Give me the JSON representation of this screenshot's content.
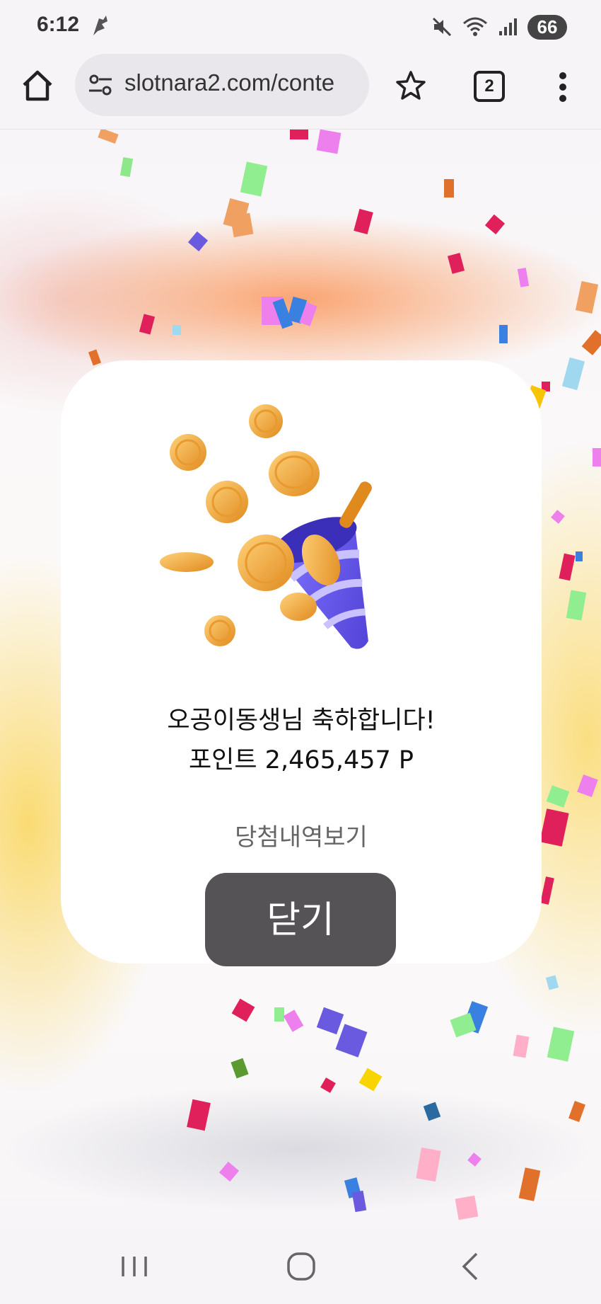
{
  "status_bar": {
    "time": "6:12",
    "battery": "66",
    "icons": [
      "notification-app-icon",
      "mute-icon",
      "wifi-icon",
      "signal-icon",
      "battery-icon"
    ]
  },
  "browser": {
    "url": "slotnara2.com/conte",
    "tab_count": "2",
    "icons": [
      "home-icon",
      "site-settings-icon",
      "bookmark-star-icon",
      "tab-switcher-icon",
      "more-menu-icon"
    ]
  },
  "dialog": {
    "message": "오공이동생님 축하합니다!",
    "points": "포인트 2,465,457 P",
    "history_link": "당첨내역보기",
    "close_button": "닫기",
    "illustration": "coin-party-popper-illustration"
  },
  "nav_bar": {
    "icons": [
      "recent-apps-icon",
      "home-nav-icon",
      "back-icon"
    ]
  },
  "colors": {
    "close_button_bg": "#555356",
    "dialog_bg": "#ffffff",
    "coin": "#f2a93b",
    "popper": "#6b5ce8"
  }
}
